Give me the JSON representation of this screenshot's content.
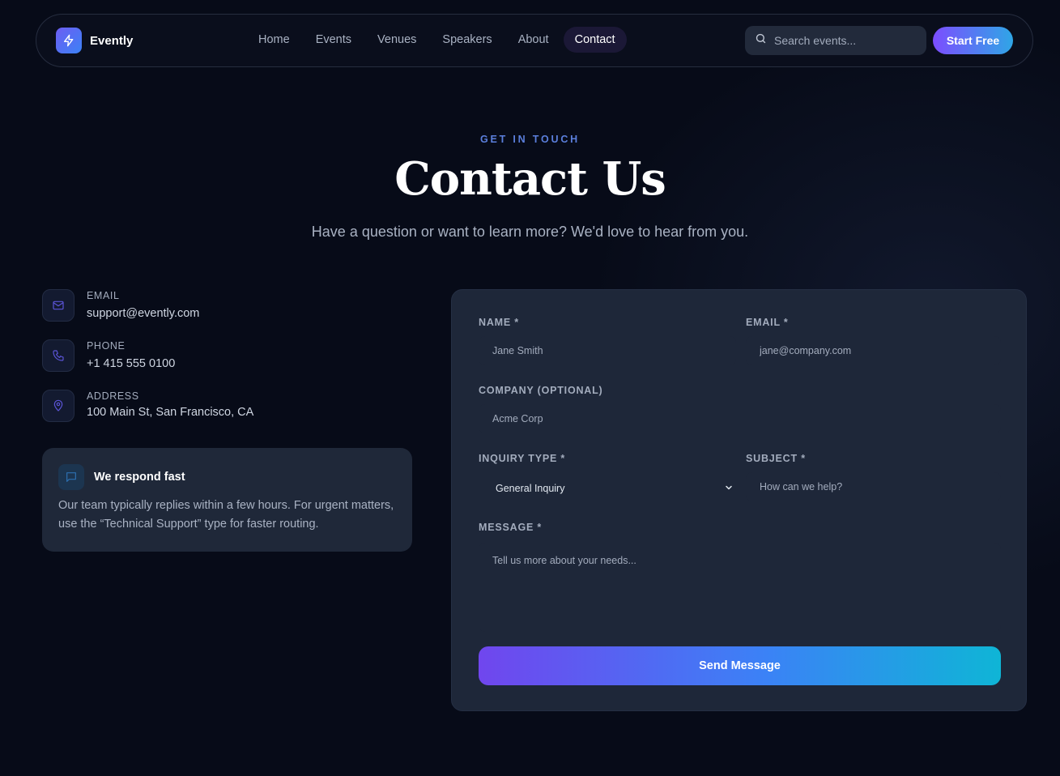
{
  "nav": {
    "brand": "Evently",
    "links": [
      "Home",
      "Events",
      "Venues",
      "Speakers",
      "About",
      "Contact"
    ],
    "active_link": "Contact",
    "search_placeholder": "Search events...",
    "cta_label": "Start Free"
  },
  "hero": {
    "eyebrow": "GET IN TOUCH",
    "title": "Contact Us",
    "subtitle": "Have a question or want to learn more? We'd love to hear from you."
  },
  "contact_info": [
    {
      "label": "EMAIL",
      "value": "support@evently.com",
      "icon": "mail-icon"
    },
    {
      "label": "PHONE",
      "value": "+1 415 555 0100",
      "icon": "phone-icon"
    },
    {
      "label": "ADDRESS",
      "value": "100 Main St, San Francisco, CA",
      "icon": "map-pin-icon"
    }
  ],
  "note": {
    "title": "We respond fast",
    "body": "Our team typically replies within a few hours. For urgent matters, use the “Technical Support” type for faster routing.",
    "icon": "chat-icon"
  },
  "form": {
    "name_label": "NAME *",
    "name_placeholder": "Jane Smith",
    "email_label": "EMAIL *",
    "email_placeholder": "jane@company.com",
    "company_label": "COMPANY (OPTIONAL)",
    "company_placeholder": "Acme Corp",
    "inquiry_label": "INQUIRY TYPE *",
    "inquiry_value": "General Inquiry",
    "subject_label": "SUBJECT *",
    "subject_placeholder": "How can we help?",
    "message_label": "MESSAGE *",
    "message_placeholder": "Tell us more about your needs...",
    "submit_label": "Send Message"
  },
  "colors": {
    "background": "#070b18",
    "card": "#1e2739",
    "accent_start": "#7046ee",
    "accent_end": "#0fb5d6"
  }
}
